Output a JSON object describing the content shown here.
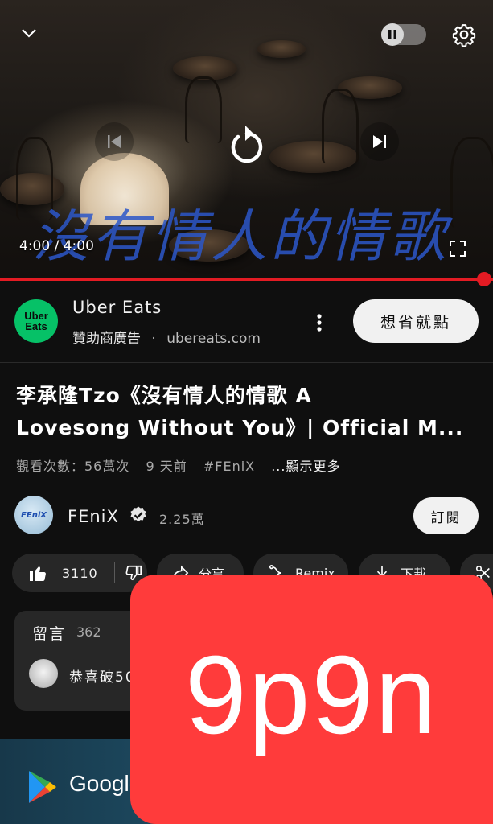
{
  "player": {
    "overlay_lyric": "沒有情人的情歌",
    "time_display": "4:00 / 4:00",
    "progress": 1.0,
    "accent_color": "#e31b23"
  },
  "ad": {
    "logo_line1": "Uber",
    "logo_line2": "Eats",
    "name": "Uber Eats",
    "sponsored": "贊助商廣告",
    "dot": "·",
    "url": "ubereats.com",
    "cta": "想省就點"
  },
  "video": {
    "title_line1": "李承隆Tzo《沒有情人的情歌 A",
    "title_line2": "Lovesong Without You》| Official M...",
    "views": "觀看次數：56萬次",
    "age": "9 天前",
    "hashtag": "#FEniX",
    "more": "...顯示更多"
  },
  "channel": {
    "avatar_text": "FEniX",
    "name": "FEniX",
    "subscribers": "2.25萬",
    "subscribe_label": "訂閱"
  },
  "actions": {
    "like_count": "3110",
    "share_label": "分享",
    "remix_label": "Remix",
    "download_label": "下載"
  },
  "comments": {
    "title": "留言",
    "count": "362",
    "first_comment": "恭喜破50"
  },
  "bottom_ad": {
    "brand": "Google"
  },
  "badge": {
    "text": "9p9n",
    "color": "#ff3b3b"
  }
}
